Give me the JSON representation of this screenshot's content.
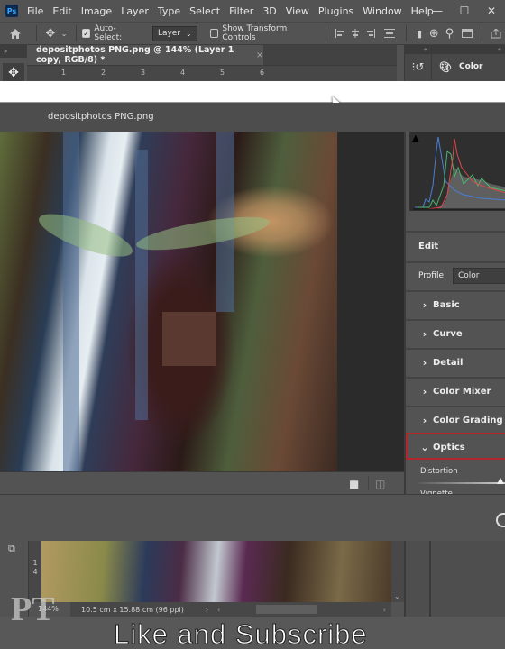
{
  "app": {
    "logo": "Ps",
    "menu": [
      "File",
      "Edit",
      "Image",
      "Layer",
      "Type",
      "Select",
      "Filter",
      "3D",
      "View",
      "Plugins",
      "Window",
      "Help"
    ],
    "window_controls": {
      "minimize": "—",
      "maximize": "☐",
      "close": "✕"
    }
  },
  "options_bar": {
    "home_icon": "home-icon",
    "move_icon": "move-tool-icon",
    "auto_select_label": "Auto-Select:",
    "auto_select_checked": true,
    "auto_select_target": "Layer",
    "show_transform_label": "Show Transform Controls",
    "show_transform_checked": false,
    "align_icons": [
      "align-left-icon",
      "align-center-icon",
      "align-right-icon",
      "distribute-icon"
    ],
    "extra_icons": [
      "3d-mode-icon",
      "search-icon",
      "workspace-icon",
      "share-icon"
    ]
  },
  "document": {
    "tab_title": "depositphotos PNG.png @ 144% (Layer 1 copy, RGB/8) *",
    "tab_close": "×",
    "ruler_ticks": [
      "1",
      "2",
      "3",
      "4",
      "5",
      "6"
    ],
    "vertical_ruler_ticks": [
      "1",
      "4"
    ]
  },
  "right_docks": {
    "collapse_glyph": "«",
    "history_icon": "history-icon",
    "color_panel_label": "Color"
  },
  "camera_raw": {
    "file_name": "depositphotos PNG.png",
    "edit_label": "Edit",
    "profile_label": "Profile",
    "profile_value": "Color",
    "sections": [
      {
        "label": "Basic",
        "expanded": false
      },
      {
        "label": "Curve",
        "expanded": false
      },
      {
        "label": "Detail",
        "expanded": false
      },
      {
        "label": "Color Mixer",
        "expanded": false
      },
      {
        "label": "Color Grading",
        "expanded": false
      },
      {
        "label": "Optics",
        "expanded": true,
        "highlighted": true
      }
    ],
    "optics": {
      "distortion_label": "Distortion",
      "distortion_value_fraction": 0.95,
      "vignette_label": "Vignette"
    },
    "highlight_color": "#b3262d",
    "footer_icons": [
      "toggle-view-icon",
      "before-after-icon"
    ]
  },
  "status": {
    "zoom": "144%",
    "doc_size": "10.5 cm x 15.88 cm (96 ppi)",
    "arrow": "›"
  },
  "overlay": {
    "watermark": "PT",
    "caption": "Like and Subscribe"
  }
}
